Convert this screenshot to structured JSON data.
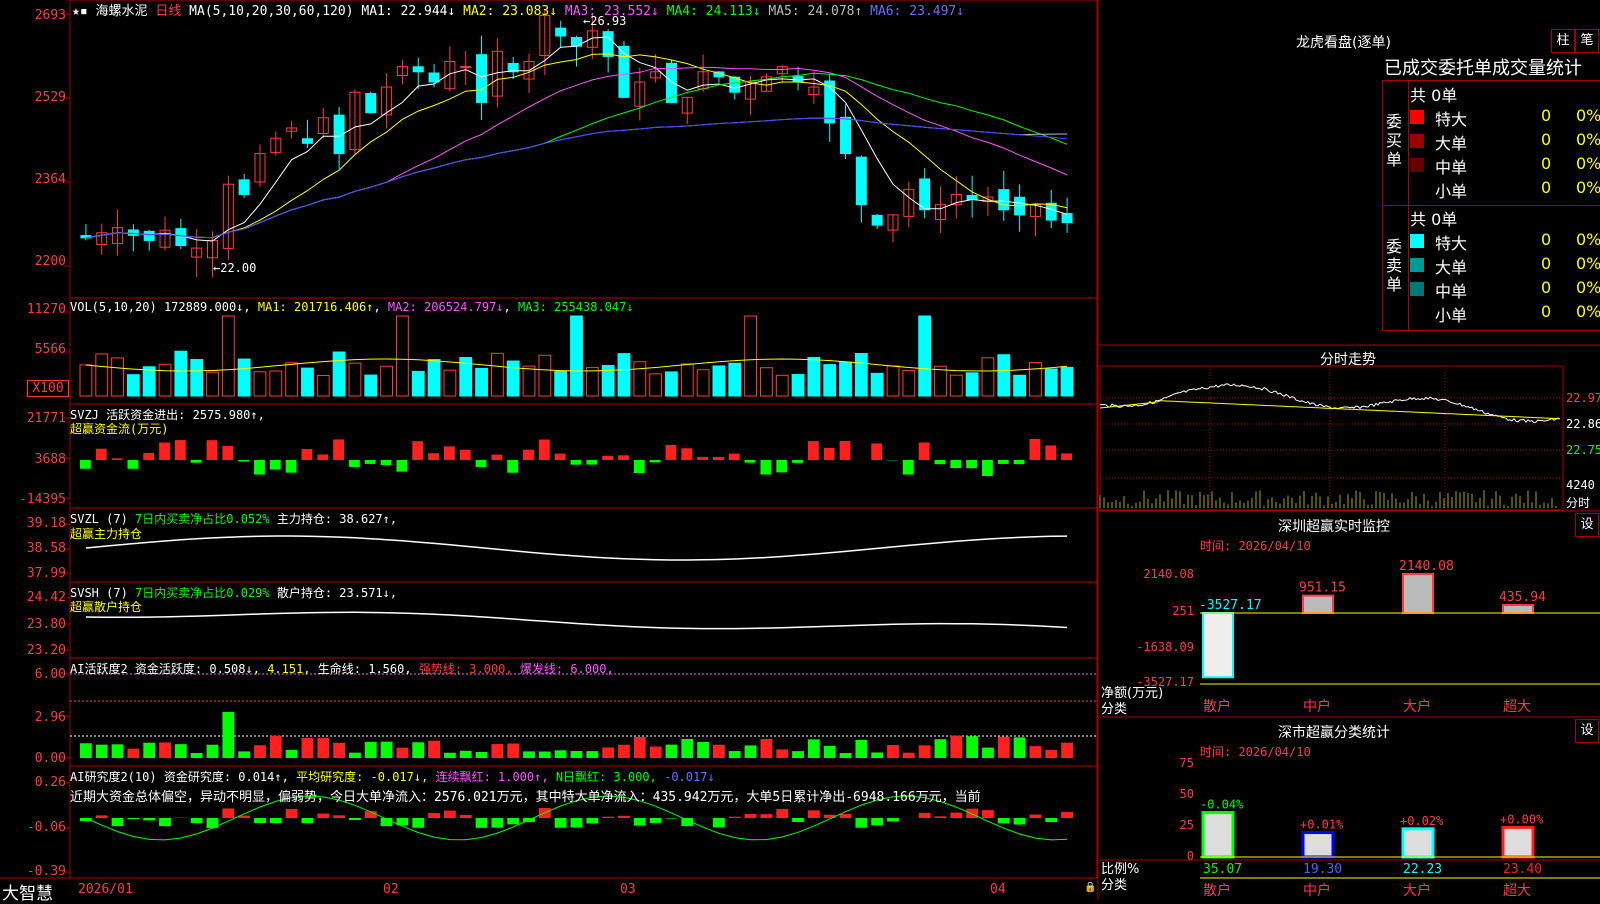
{
  "app": {
    "name": "大智慧"
  },
  "stock": {
    "name": "海螺水泥",
    "period": "日线"
  },
  "ma_header": {
    "params": "MA(5,10,20,30,60,120)",
    "ma1": "MA1: 22.944↓",
    "ma2": "MA2: 23.083↓",
    "ma3": "MA3: 23.552↓",
    "ma4": "MA4: 24.113↓",
    "ma5": "MA5: 24.078↑",
    "ma6": "MA6: 23.497↓"
  },
  "price_axis": [
    "2693",
    "2529",
    "2364",
    "2200"
  ],
  "price_marks": {
    "high": "26.93",
    "low": "22.00"
  },
  "vol_header": {
    "params": "VOL(5,10,20)",
    "vol": "172889.000↓",
    "ma1": "MA1: 201716.406↑",
    "ma2": "MA2: 206524.797↓",
    "ma3": "MA3: 255438.047↓"
  },
  "vol_axis": [
    "11270",
    "5566",
    "X100"
  ],
  "svzj": {
    "name": "SVZJ",
    "label": "活跃资金进出: 2575.980↑,",
    "sub": "超赢资金流(万元)",
    "axis": [
      "21771",
      "3688",
      "-14395"
    ]
  },
  "svzl": {
    "name": "SVZL (7)",
    "label1": "7日内买卖净占比0.052%",
    "label2": "主力持仓: 38.627↑,",
    "sub": "超赢主力持仓",
    "axis": [
      "39.18",
      "38.58",
      "37.99"
    ]
  },
  "svsh": {
    "name": "SVSH (7)",
    "label1": "7日内买卖净占比0.029%",
    "label2": "散户持仓: 23.571↓,",
    "sub": "超赢散户持仓",
    "axis": [
      "24.42",
      "23.80",
      "23.20"
    ]
  },
  "ai_active": {
    "name": "AI活跃度2",
    "label": "资金活跃度: 0.508↓",
    "v2": "4.151,",
    "life": "生命线: 1.560,",
    "strong": "强势线: 3.000,",
    "burst": "爆发线: 6.000,",
    "axis": [
      "6.00",
      "2.96",
      "0.00"
    ]
  },
  "ai_research": {
    "name": "AI研究度2(10)",
    "label": "资金研究度: 0.014↑,",
    "avg": "平均研究度: -0.017↓,",
    "cont": "连续飘红: 1.000↑,",
    "nday": "N日飘红: 3.000,",
    "last": "-0.017↓",
    "axis": [
      "0.26",
      "-0.06",
      "-0.39"
    ],
    "comment": "近期大资金总体偏空，异动不明显，偏弱势，今日大单净流入：2576.021万元，其中特大单净流入：435.942万元，大单5日累计净出-6948.166万元，当前"
  },
  "x_axis": [
    "2026/01",
    "02",
    "03",
    "04"
  ],
  "dragon_tiger": {
    "title": "龙虎看盘(逐单)",
    "btn1": "柱",
    "btn2": "笔",
    "header": "已成交委托单成交量统计",
    "buy_label": "委买单",
    "sell_label": "委卖单",
    "buy_total": "共 0单",
    "sell_total": "共 0单",
    "buy_rows": [
      {
        "name": "特大",
        "count": "0",
        "pct": "0%",
        "color": "#ff0000"
      },
      {
        "name": "大单",
        "count": "0",
        "pct": "0%",
        "color": "#990000"
      },
      {
        "name": "中单",
        "count": "0",
        "pct": "0%",
        "color": "#660000"
      },
      {
        "name": "小单",
        "count": "0",
        "pct": "0%",
        "color": ""
      }
    ],
    "sell_rows": [
      {
        "name": "特大",
        "count": "0",
        "pct": "0%",
        "color": "#00ffff"
      },
      {
        "name": "大单",
        "count": "0",
        "pct": "0%",
        "color": "#009999"
      },
      {
        "name": "中单",
        "count": "0",
        "pct": "0%",
        "color": "#007777"
      },
      {
        "name": "小单",
        "count": "0",
        "pct": "0%",
        "color": ""
      }
    ]
  },
  "intraday": {
    "title": "分时走势",
    "axis": [
      "22.97",
      "22.86",
      "22.75"
    ],
    "vol_axis": [
      "4240",
      "分时"
    ]
  },
  "sz_monitor": {
    "title": "深圳超赢实时监控",
    "btn": "设",
    "time": "时间: 2026/04/10",
    "axis": [
      "2140.08",
      "251",
      "-1638.09",
      "-3527.17"
    ],
    "footer1": "净额(万元)",
    "footer2": "分类",
    "categories": [
      "散户",
      "中户",
      "大户",
      "超大"
    ],
    "values": [
      -3527.17,
      951.15,
      2140.08,
      435.94
    ],
    "labels": [
      "-3527.17",
      "951.15",
      "2140.08",
      "435.94"
    ]
  },
  "sz_class": {
    "title": "深市超赢分类统计",
    "btn": "设",
    "time": "时间: 2026/04/10",
    "axis": [
      "75",
      "50",
      "25",
      "0"
    ],
    "footer1": "比例%",
    "footer2": "分类",
    "categories": [
      "散户",
      "中户",
      "大户",
      "超大"
    ],
    "values": [
      35.07,
      19.3,
      22.23,
      23.4
    ],
    "value_labels": [
      "35.07",
      "19.30",
      "22.23",
      "23.40"
    ],
    "changes": [
      "-0.04%",
      "+0.01%",
      "+0.02%",
      "+0.00%"
    ]
  }
}
